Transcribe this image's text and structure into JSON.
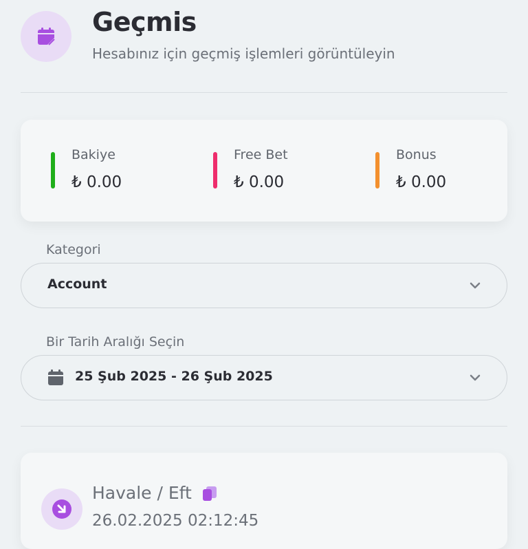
{
  "header": {
    "icon": "calendar-edit-icon",
    "title": "Geçmis",
    "subtitle": "Hesabınız için geçmiş işlemleri görüntüleyin"
  },
  "balances": [
    {
      "label": "Bakiye",
      "value": "₺ 0.00",
      "color": "#1fae1a"
    },
    {
      "label": "Free Bet",
      "value": "₺ 0.00",
      "color": "#ee2d6d"
    },
    {
      "label": "Bonus",
      "value": "₺ 0.00",
      "color": "#f3902e"
    }
  ],
  "category": {
    "label": "Kategori",
    "value": "Account",
    "icon": "chevron-down-icon"
  },
  "date_range": {
    "label": "Bir Tarih Aralığı Seçin",
    "value": "25 Şub 2025 - 26 Şub 2025",
    "icon": "calendar-icon"
  },
  "transactions": [
    {
      "title": "Havale / Eft",
      "date": "26.02.2025 02:12:45",
      "icon": "arrow-down-right-icon",
      "copy_icon": "copy-icon"
    }
  ],
  "colors": {
    "accent": "#a84ee0",
    "background": "#eef2f4",
    "card": "#f5f7f8"
  }
}
